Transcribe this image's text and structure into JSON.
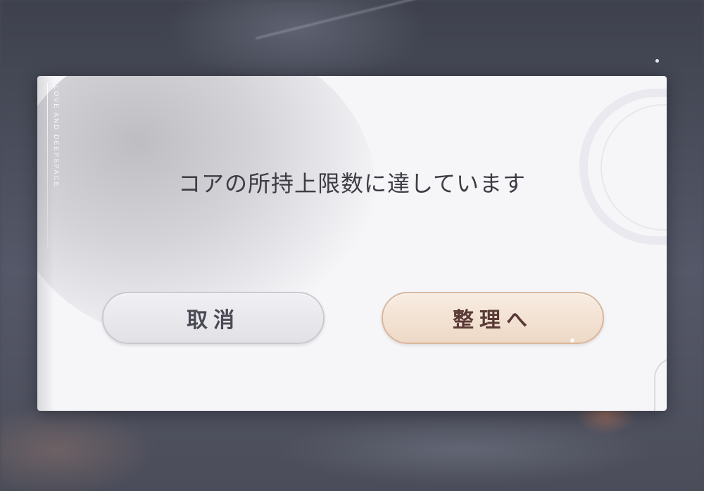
{
  "dialog": {
    "brand": "LOVE AND DEEPSPACE",
    "message": "コアの所持上限数に達しています",
    "cancel_label": "取消",
    "confirm_label": "整理へ"
  },
  "colors": {
    "dialog_background": "#f6f6f9",
    "message_text": "#3c3c44",
    "cancel_button": "#e6e6eb",
    "confirm_button": "#f2e0cf",
    "confirm_text": "#5a3a36"
  }
}
